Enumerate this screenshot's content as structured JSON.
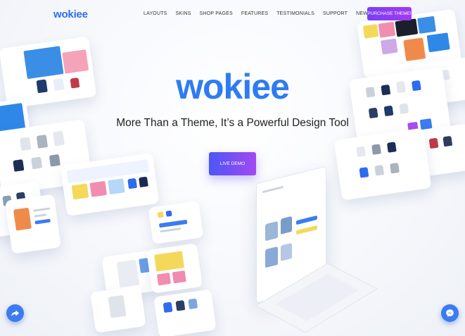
{
  "header": {
    "logo": "wokiee",
    "nav": [
      {
        "label": "LAYOUTS"
      },
      {
        "label": "SKINS"
      },
      {
        "label": "SHOP PAGES"
      },
      {
        "label": "FEATURES"
      },
      {
        "label": "TESTIMONIALS"
      },
      {
        "label": "SUPPORT"
      },
      {
        "label": "NEW"
      }
    ],
    "purchase_label": "PURCHASE THEME!"
  },
  "hero": {
    "title": "wokiee",
    "subtitle": "More Than a Theme, It’s a Powerful Design Tool",
    "demo_label": "LIVE DEMO"
  },
  "fabs": {
    "left_icon": "share-icon",
    "right_icon": "messenger-icon"
  },
  "colors": {
    "brand": "#2d7cf3",
    "purchase_gradient": [
      "#7b3ff2",
      "#a23af5"
    ],
    "demo_gradient": [
      "#4b57f5",
      "#a348f1"
    ]
  }
}
